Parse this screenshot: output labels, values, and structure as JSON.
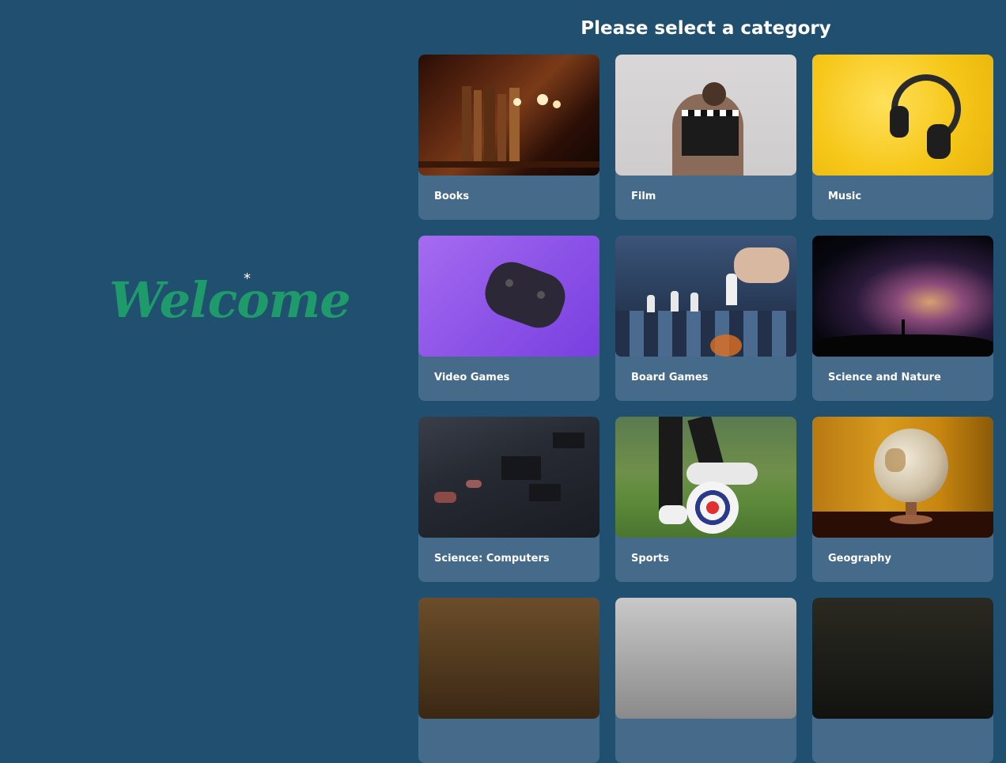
{
  "welcome": {
    "text": "Welcome",
    "star": "*"
  },
  "page_title": "Please select a category",
  "categories": [
    {
      "label": "Books",
      "icon": "books-shelf-image"
    },
    {
      "label": "Film",
      "icon": "clapperboard-image"
    },
    {
      "label": "Music",
      "icon": "headphones-image"
    },
    {
      "label": "Video Games",
      "icon": "gamepad-image"
    },
    {
      "label": "Board Games",
      "icon": "chess-image"
    },
    {
      "label": "Science and Nature",
      "icon": "galaxy-image"
    },
    {
      "label": "Science: Computers",
      "icon": "circuit-board-image"
    },
    {
      "label": "Sports",
      "icon": "soccer-ball-image"
    },
    {
      "label": "Geography",
      "icon": "globe-image"
    },
    {
      "label": "",
      "icon": "partial-image"
    },
    {
      "label": "",
      "icon": "partial-image"
    },
    {
      "label": "",
      "icon": "partial-image"
    }
  ],
  "colors": {
    "background": "#214f6f",
    "card": "#466a8a",
    "welcome": "#1f9a6b",
    "title": "#ffffff"
  }
}
